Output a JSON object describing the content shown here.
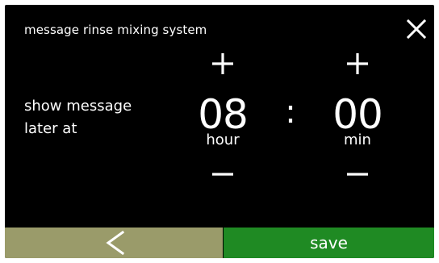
{
  "header": {
    "title": "message rinse mixing system",
    "close_icon": "close-icon"
  },
  "setting": {
    "label_line1": "show message",
    "label_line2": "later at"
  },
  "time": {
    "hour_value": "08",
    "hour_unit": "hour",
    "separator": ":",
    "minute_value": "00",
    "minute_unit": "min",
    "increment_icon": "plus-icon",
    "decrement_icon": "minus-icon"
  },
  "footer": {
    "back_icon": "chevron-left-icon",
    "save_label": "save",
    "back_color": "#9a9b6a",
    "save_color": "#1f8a23"
  }
}
